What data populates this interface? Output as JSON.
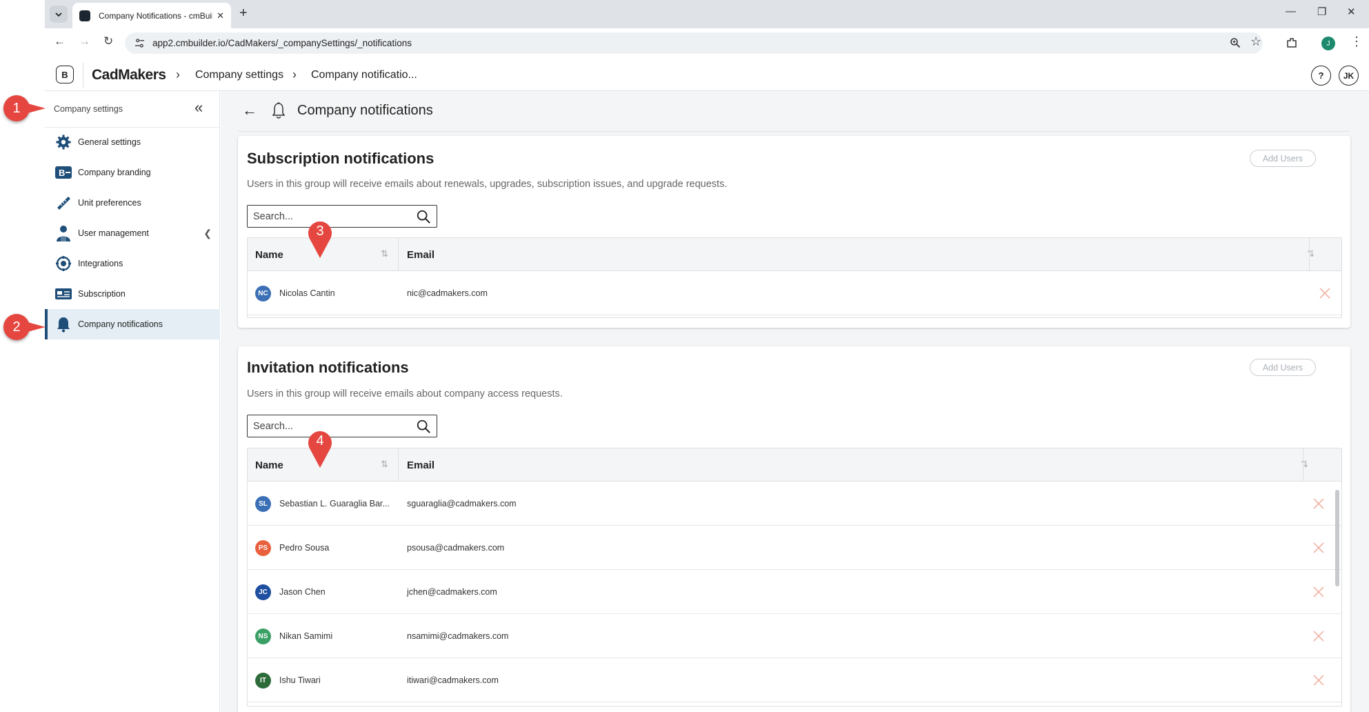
{
  "browser": {
    "tab_title": "Company Notifications - cmBuil",
    "tab_close": "✕",
    "new_tab": "+",
    "url": "app2.cmbuilder.io/CadMakers/_companySettings/_notifications",
    "profile_initial": "J"
  },
  "header": {
    "brand": "CadMakers",
    "breadcrumbs": [
      "Company settings",
      "Company notificatio..."
    ],
    "help": "?",
    "user_initials": "JK"
  },
  "sidebar": {
    "heading": "Company settings",
    "items": [
      {
        "label": "General settings",
        "icon": "gear-icon"
      },
      {
        "label": "Company branding",
        "icon": "branding-icon"
      },
      {
        "label": "Unit preferences",
        "icon": "ruler-icon"
      },
      {
        "label": "User management",
        "icon": "user-icon"
      },
      {
        "label": "Integrations",
        "icon": "integrations-icon"
      },
      {
        "label": "Subscription",
        "icon": "subscription-icon"
      },
      {
        "label": "Company notifications",
        "icon": "bell-icon"
      }
    ],
    "active_index": 6
  },
  "page": {
    "title": "Company notifications"
  },
  "sections": [
    {
      "title": "Subscription notifications",
      "description": "Users in this group will receive emails about renewals, upgrades, subscription issues, and upgrade requests.",
      "add_label": "Add Users",
      "search_placeholder": "Search...",
      "columns": [
        "Name",
        "Email"
      ],
      "rows": [
        {
          "initials": "NC",
          "name": "Nicolas Cantin",
          "email": "nic@cadmakers.com",
          "color": "#3b6fb6"
        }
      ]
    },
    {
      "title": "Invitation notifications",
      "description": "Users in this group will receive emails about company access requests.",
      "add_label": "Add Users",
      "search_placeholder": "Search...",
      "columns": [
        "Name",
        "Email"
      ],
      "rows": [
        {
          "initials": "SL",
          "name": "Sebastian L. Guaraglia Bar...",
          "email": "sguaraglia@cadmakers.com",
          "color": "#3b6fb6"
        },
        {
          "initials": "PS",
          "name": "Pedro Sousa",
          "email": "psousa@cadmakers.com",
          "color": "#e8603c"
        },
        {
          "initials": "JC",
          "name": "Jason Chen",
          "email": "jchen@cadmakers.com",
          "color": "#1f4fa0"
        },
        {
          "initials": "NS",
          "name": "Nikan Samimi",
          "email": "nsamimi@cadmakers.com",
          "color": "#3aa065"
        },
        {
          "initials": "IT",
          "name": "Ishu Tiwari",
          "email": "itiwari@cadmakers.com",
          "color": "#2e6b3a"
        }
      ]
    }
  ],
  "annotations": [
    "1",
    "2",
    "3",
    "4"
  ],
  "colors": {
    "accent": "#1f4e79",
    "active_bg": "#e4eef4",
    "delete_x": "#f2b3a6",
    "callout": "#e5463f"
  }
}
